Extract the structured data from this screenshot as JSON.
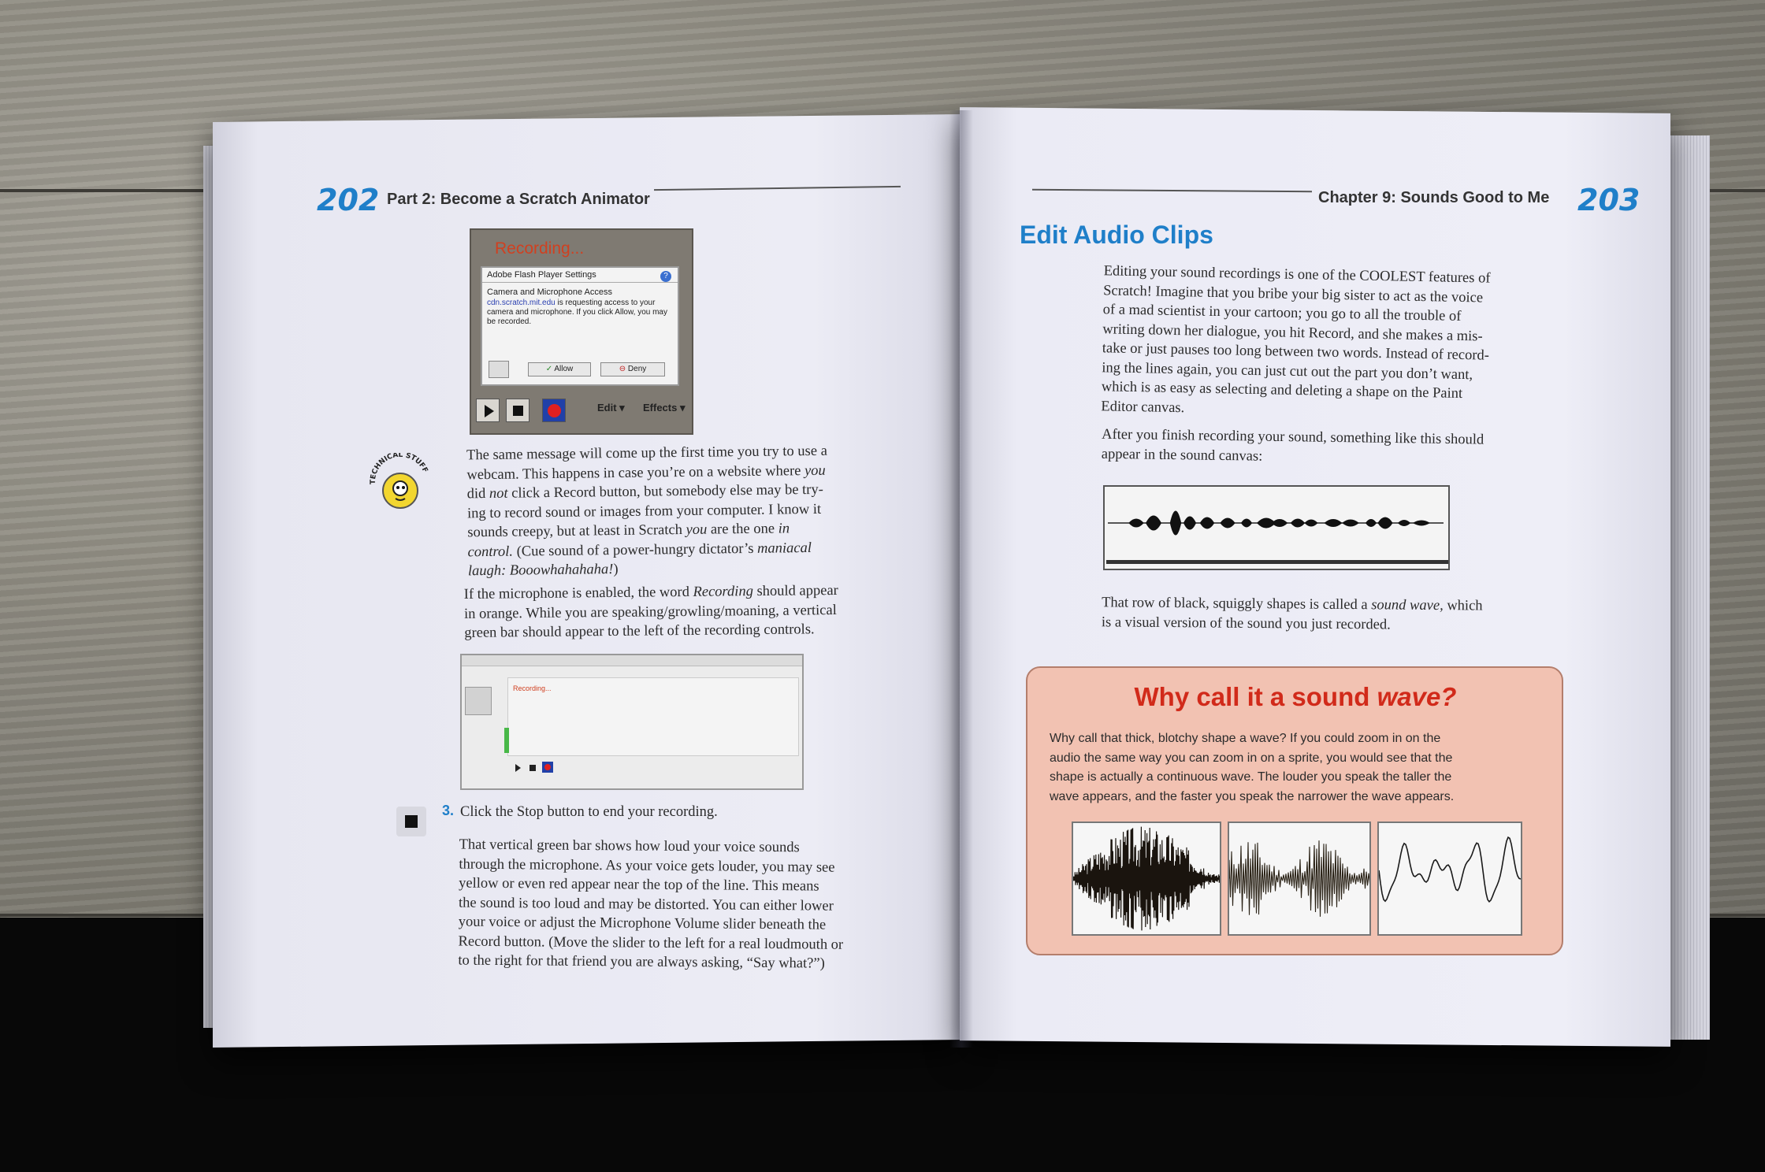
{
  "left_page": {
    "page_number": "202",
    "running_head": "Part 2: Become a Scratch Animator",
    "screenshot1": {
      "recording_label": "Recording...",
      "dialog_title": "Adobe Flash Player Settings",
      "dialog_subtitle": "Camera and Microphone Access",
      "dialog_link": "cdn.scratch.mit.edu",
      "dialog_message": " is requesting access to your camera and microphone. If you click Allow, you may be recorded.",
      "allow_label": "Allow",
      "deny_label": "Deny",
      "edit_menu": "Edit ▾",
      "effects_menu": "Effects ▾"
    },
    "technical_icon": "technical-stuff-icon",
    "technical_label": "TECHNICAL STUFF",
    "tip_paragraph": [
      "The same message will come up the first time you try to use a",
      "webcam. This happens in case you’re on a website where ",
      "you",
      "did ",
      "not",
      " click a Record button, but somebody else may be try-",
      "ing to record sound or images from your computer. I know it",
      "sounds creepy, but at least in Scratch ",
      "you",
      " are the one ",
      "in",
      "control.",
      " (Cue sound of a power-hungry dictator’s ",
      "maniacal",
      "laugh: Booowhahahaha!",
      ")"
    ],
    "mic_paragraph": [
      "If the microphone is enabled, the word ",
      "Recording",
      " should appear",
      "in orange. While you are speaking/growling/moaning, a vertical",
      "green bar should appear to the left of the recording controls."
    ],
    "screenshot2_recording": "Recording...",
    "step_number": "3.",
    "step_text": "Click the Stop button to end your recording.",
    "stop_icon": "stop-icon",
    "stop_paragraph": [
      "That vertical green bar shows how loud your voice sounds",
      "through the microphone. As your voice gets louder, you may see",
      "yellow or even red appear near the top of the line. This means",
      "the sound is too loud and may be distorted. You can either lower",
      "your voice or adjust the Microphone Volume slider beneath the",
      "Record button. (Move the slider to the left for a real loudmouth or",
      "to the right for that friend you are always asking, “Say what?”)"
    ]
  },
  "right_page": {
    "page_number": "203",
    "running_head": "Chapter 9: Sounds Good to Me",
    "section_title": "Edit Audio Clips",
    "intro_paragraph": [
      "Editing your sound recordings is one of the COOLEST features of",
      "Scratch! Imagine that you bribe your big sister to act as the voice",
      "of a mad scientist in your cartoon; you go to all the trouble of",
      "writing down her dialogue, you hit Record, and she makes a mis-",
      "take or just pauses too long between two words. Instead of record-",
      "ing the lines again, you can just cut out the part you don’t want,",
      "which is as easy as selecting and deleting a shape on the Paint",
      "Editor canvas."
    ],
    "after_paragraph": [
      "After you finish recording your sound, something like this should",
      "appear in the sound canvas:"
    ],
    "wave_caption": [
      "That row of black, squiggly shapes is called a ",
      "sound wave,",
      " which",
      "is a visual version of the sound you just recorded."
    ],
    "sidebar": {
      "title_plain": "Why call it a sound ",
      "title_em": "wave?",
      "text": [
        "Why call that thick, blotchy shape a wave? If you could zoom in on the",
        "audio the same way you can zoom in on a sprite, you would see that the",
        "shape is actually a continuous wave. The louder you speak the taller the",
        "wave appears, and the faster you speak the narrower the wave appears."
      ]
    }
  },
  "colors": {
    "accent_blue": "#1f7fc9",
    "sidebar_red": "#d12a1a",
    "sidebar_bg": "#f2c2b2",
    "recording_orange": "#d04020"
  }
}
